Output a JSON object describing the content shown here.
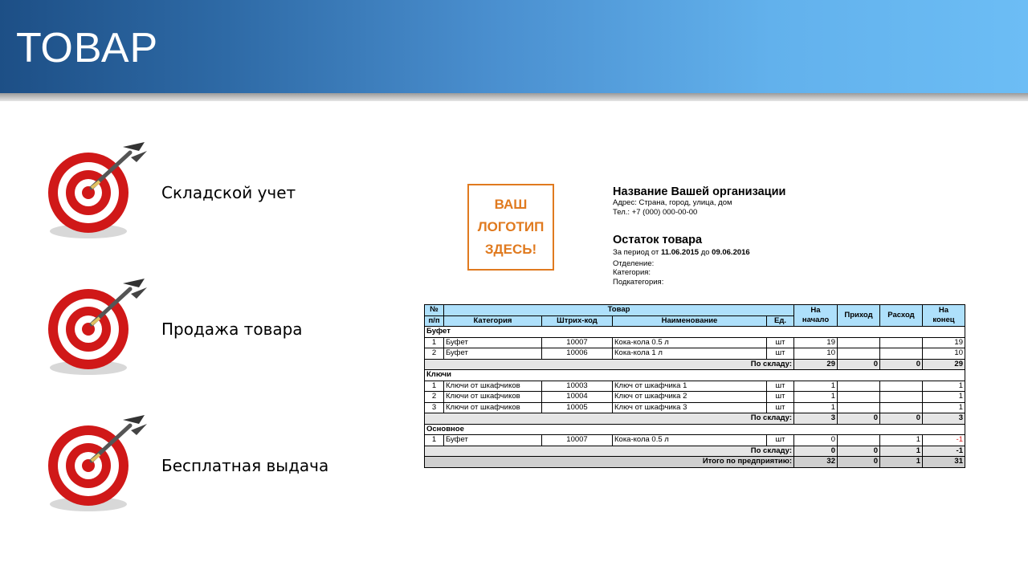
{
  "slide": {
    "title": "ТОВАР"
  },
  "bullets": [
    {
      "label": "Складской учет",
      "icon": "target-icon"
    },
    {
      "label": "Продажа товара",
      "icon": "target-icon"
    },
    {
      "label": "Бесплатная выдача",
      "icon": "target-icon"
    }
  ],
  "logo": {
    "line1": "ВАШ",
    "line2": "ЛОГОТИП",
    "line3": "ЗДЕСЬ!",
    "color": "#e07a1f"
  },
  "org": {
    "name": "Название Вашей организации",
    "address": "Адрес: Страна, город, улица, дом",
    "phone": "Тел.: +7 (000) 000-00-00"
  },
  "report": {
    "title": "Остаток товара",
    "period_prefix": "За период от",
    "period_from": "11.06.2015",
    "period_mid": "до",
    "period_to": "09.06.2016",
    "department": "Отделение:",
    "category": "Категория:",
    "subcategory": "Подкатегория:"
  },
  "table": {
    "header_color": "#aee0fb",
    "headers": {
      "num_top": "№",
      "num_bottom": "п/п",
      "product": "Товар",
      "category": "Категория",
      "barcode": "Штрих-код",
      "name": "Наименование",
      "unit": "Ед.",
      "start_top": "На",
      "start_bottom": "начало",
      "income": "Приход",
      "expense": "Расход",
      "end_top": "На",
      "end_bottom": "конец"
    },
    "groups": [
      {
        "title": "Буфет",
        "rows": [
          {
            "n": "1",
            "category": "Буфет",
            "barcode": "10007",
            "name": "Кока-кола 0.5 л",
            "unit": "шт",
            "start": "19",
            "income": "",
            "expense": "",
            "end": "19"
          },
          {
            "n": "2",
            "category": "Буфет",
            "barcode": "10006",
            "name": "Кока-кола 1 л",
            "unit": "шт",
            "start": "10",
            "income": "",
            "expense": "",
            "end": "10"
          }
        ],
        "subtotal": {
          "label": "По складу:",
          "start": "29",
          "income": "0",
          "expense": "0",
          "end": "29"
        }
      },
      {
        "title": "Ключи",
        "rows": [
          {
            "n": "1",
            "category": "Ключи от шкафчиков",
            "barcode": "10003",
            "name": "Ключ от шкафчика 1",
            "unit": "шт",
            "start": "1",
            "income": "",
            "expense": "",
            "end": "1"
          },
          {
            "n": "2",
            "category": "Ключи от шкафчиков",
            "barcode": "10004",
            "name": "Ключ от шкафчика 2",
            "unit": "шт",
            "start": "1",
            "income": "",
            "expense": "",
            "end": "1"
          },
          {
            "n": "3",
            "category": "Ключи от шкафчиков",
            "barcode": "10005",
            "name": "Ключ от шкафчика 3",
            "unit": "шт",
            "start": "1",
            "income": "",
            "expense": "",
            "end": "1"
          }
        ],
        "subtotal": {
          "label": "По складу:",
          "start": "3",
          "income": "0",
          "expense": "0",
          "end": "3"
        }
      },
      {
        "title": "Основное",
        "rows": [
          {
            "n": "1",
            "category": "Буфет",
            "barcode": "10007",
            "name": "Кока-кола 0.5 л",
            "unit": "шт",
            "start": "0",
            "income": "",
            "expense": "1",
            "end": "-1"
          }
        ],
        "subtotal": {
          "label": "По складу:",
          "start": "0",
          "income": "0",
          "expense": "1",
          "end": "-1"
        }
      }
    ],
    "total": {
      "label": "Итого по предприятию:",
      "start": "32",
      "income": "0",
      "expense": "1",
      "end": "31"
    }
  }
}
